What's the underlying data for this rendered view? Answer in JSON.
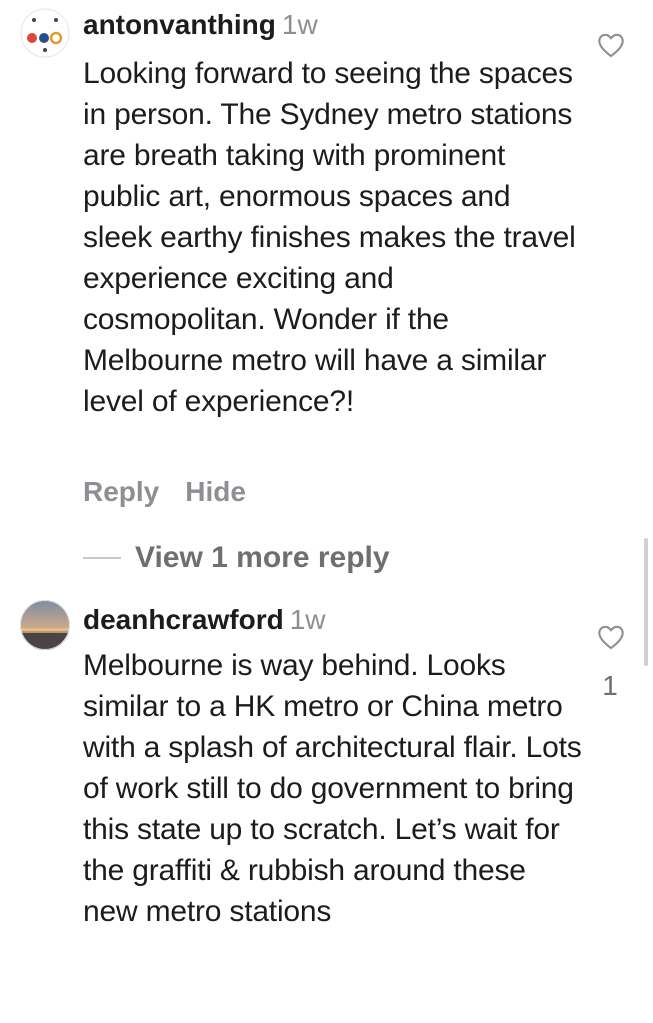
{
  "comments": [
    {
      "username": "antonvanthing",
      "timestamp": "1w",
      "text": "Looking forward to seeing the spaces in person. The Sydney metro stations are breath taking with prominent public art, enormous spaces and sleek earthy finishes makes the travel experience exciting and cosmopolitan. Wonder if the Melbourne metro will have a similar level of experience?!",
      "actions": {
        "reply": "Reply",
        "hide": "Hide"
      },
      "view_more": "View 1 more reply",
      "icon": "heart-outline-icon"
    },
    {
      "username": "deanhcrawford",
      "timestamp": "1w",
      "text": "Melbourne is way behind. Looks similar to a HK metro or China metro with a splash of architectural flair. Lots of work still to do government to bring this state up to scratch. Let’s wait for the graffiti & rubbish around these new metro stations",
      "like_count": "1",
      "icon": "heart-outline-icon"
    }
  ],
  "colors": {
    "text": "#1c1c1e",
    "muted": "#8e8e93",
    "accent": "#3b82f6"
  }
}
